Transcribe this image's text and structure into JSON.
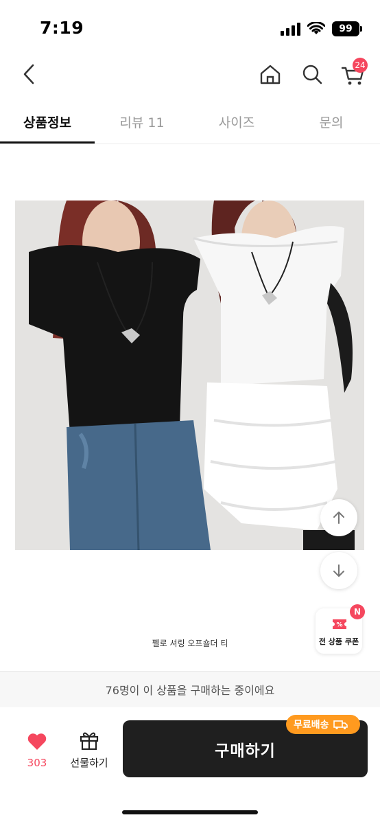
{
  "status_bar": {
    "time": "7:19",
    "battery": "99"
  },
  "nav": {
    "cart_count": "24"
  },
  "tabs": [
    {
      "label": "상품정보",
      "active": true
    },
    {
      "label": "리뷰 11",
      "active": false
    },
    {
      "label": "사이즈",
      "active": false
    },
    {
      "label": "문의",
      "active": false
    }
  ],
  "product": {
    "caption": "펠로 셔링 오프숄더 티"
  },
  "coupon": {
    "label": "전 상품 쿠폰",
    "badge": "N"
  },
  "purchase": {
    "buyer_banner": "76명이 이 상품을 구매하는 중이에요",
    "like_count": "303",
    "gift_label": "선물하기",
    "buy_label": "구매하기",
    "free_shipping": "무료배송"
  },
  "colors": {
    "accent": "#f5475e",
    "buy_button": "#1f1f1f",
    "free_shipping": "#ff9a1f"
  }
}
